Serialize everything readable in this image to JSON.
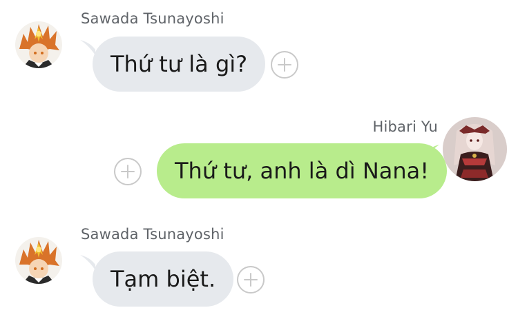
{
  "messages": [
    {
      "direction": "incoming",
      "sender": "Sawada Tsunayoshi",
      "text": "Thứ tư là gì?"
    },
    {
      "direction": "outgoing",
      "sender": "Hibari Yu",
      "text": "Thứ tư, anh là dì Nana!"
    },
    {
      "direction": "incoming",
      "sender": "Sawada Tsunayoshi",
      "text": "Tạm biệt."
    }
  ],
  "colors": {
    "incoming_bubble": "#e6e9ed",
    "outgoing_bubble": "#b8ec8c",
    "sender_name": "#5f6368",
    "react_icon": "#c9c9c9"
  },
  "icons": {
    "add_reaction": "add-reaction-icon"
  }
}
